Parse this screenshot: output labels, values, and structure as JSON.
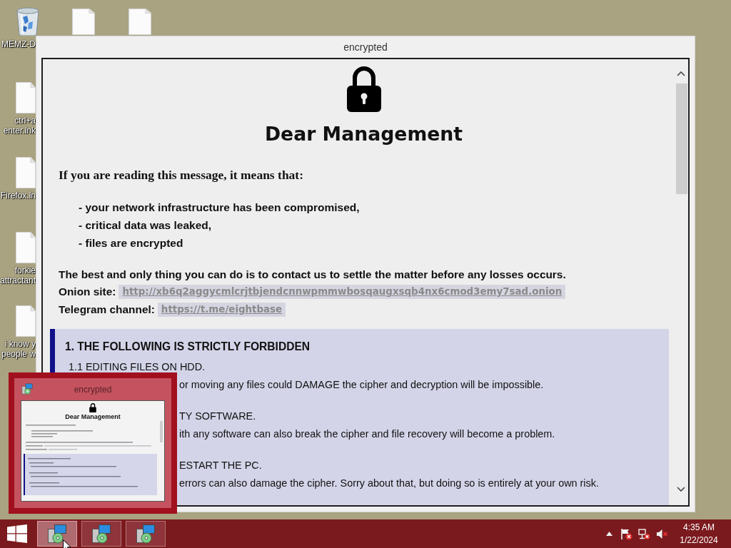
{
  "desktop": {
    "icons": [
      {
        "kind": "recycle-bin",
        "label_lines": [
          "MEMZ-D"
        ]
      },
      {
        "kind": "file"
      },
      {
        "kind": "file"
      },
      {
        "kind": "file",
        "label_lines": [
          "ctrl+a",
          "enter.lnk"
        ]
      },
      {
        "kind": "file",
        "label_lines": [
          "Firefox.ln"
        ]
      },
      {
        "kind": "file",
        "label_lines": [
          "forkie",
          "attractant"
        ]
      },
      {
        "kind": "file",
        "label_lines": [
          "i know y",
          "people w"
        ]
      }
    ]
  },
  "window": {
    "title": "encrypted",
    "heading": "Dear Management",
    "intro": "If you are reading this message, it means that:",
    "bullets": [
      "- your network infrastructure has been compromised,",
      "- critical data was leaked,",
      "- files are encrypted"
    ],
    "advice": "The best and only thing you can do is to contact us to settle the matter before any losses occurs.",
    "contacts": [
      {
        "label": "Onion site:",
        "link": "http://xb6q2aggycmlcrjtbjendcnnwpmmwbosqaugxsqb4nx6cmod3emy7sad.onion"
      },
      {
        "label": "Telegram channel:",
        "link": "https://t.me/eightbase"
      }
    ],
    "notice": {
      "heading": "1. THE FOLLOWING IS STRICTLY FORBIDDEN",
      "items": [
        {
          "title": "1.1 EDITING FILES ON HDD.",
          "text": "or moving any files could DAMAGE the cipher and decryption will be impossible."
        },
        {
          "title": "TY SOFTWARE.",
          "text": "ith any software can also break the cipher and file recovery will become a problem."
        },
        {
          "title": "ESTART THE PC.",
          "text": "errors can also damage the cipher. Sorry about that, but doing so is entirely at your own risk."
        }
      ]
    }
  },
  "taskbar_preview": {
    "title": "encrypted",
    "heading": "Dear Management"
  },
  "taskbar": {
    "buttons": [
      {
        "selected": true
      },
      {
        "selected": false
      },
      {
        "selected": false
      }
    ],
    "tray": {
      "action_center_alert": true,
      "network_connected": false,
      "volume_muted": true
    },
    "clock": {
      "time": "4:35 AM",
      "date": "1/22/2024"
    }
  }
}
